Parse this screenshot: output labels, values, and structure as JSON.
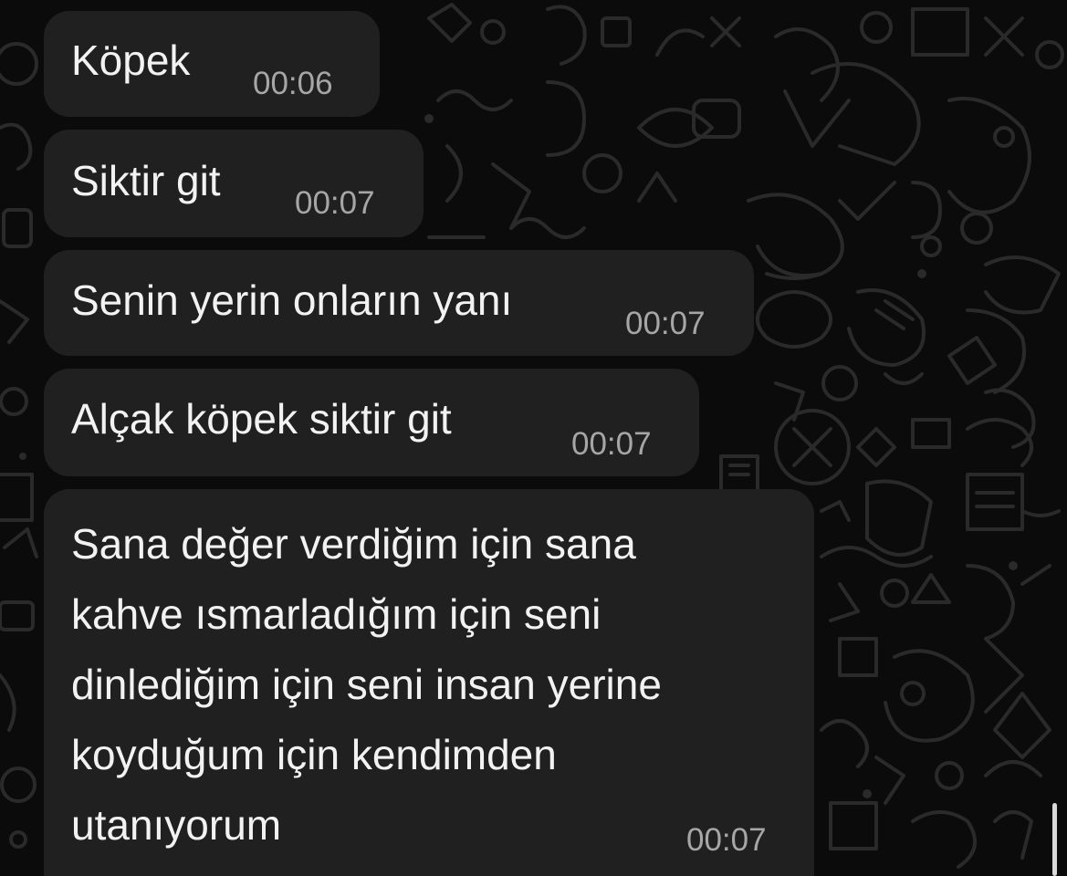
{
  "colors": {
    "background": "#0b0b0b",
    "bubble": "#202020",
    "text": "#f2f2f2",
    "timestamp": "#a6a6a6",
    "doodle": "#2a2a2a"
  },
  "messages": [
    {
      "text": "Köpek",
      "time": "00:06"
    },
    {
      "text": "Siktir git",
      "time": "00:07"
    },
    {
      "text": "Senin yerin onların yanı",
      "time": "00:07"
    },
    {
      "text": "Alçak köpek siktir git",
      "time": "00:07"
    },
    {
      "lines": [
        "Sana değer verdiğim için sana",
        "kahve ısmarladığım için seni",
        "dinlediğim için seni insan yerine",
        "koyduğum için kendimden",
        "utanıyorum"
      ],
      "time": "00:07"
    }
  ]
}
